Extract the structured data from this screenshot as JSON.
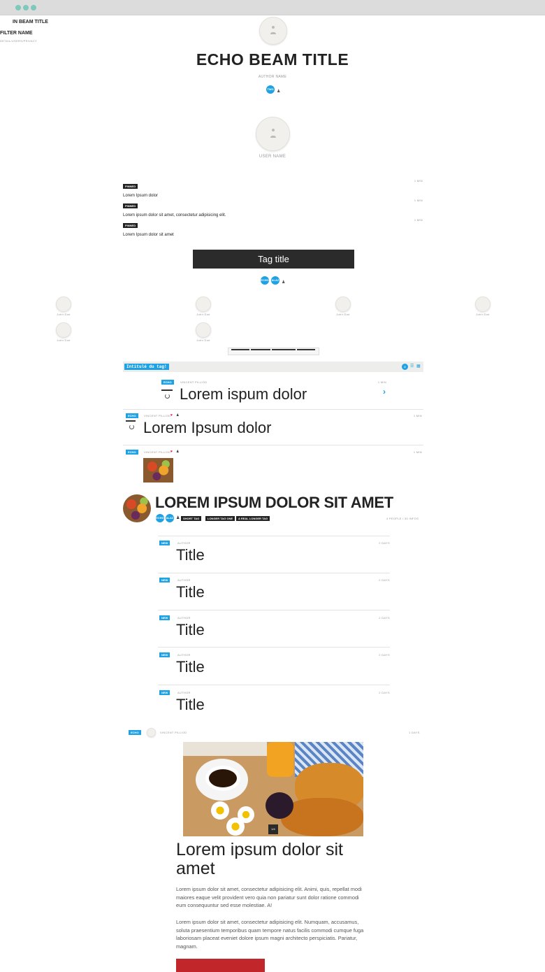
{
  "sidebar": {
    "beam_title": "IN BEAM TITLE",
    "filter_name": "FILTER NAME",
    "filter_sub": "DETAIL/USERS/PRIVACY"
  },
  "header": {
    "title": "ECHO BEAM TITLE",
    "author": "AUTHOR NAME",
    "badge": "TWO",
    "user_name": "USER NAME"
  },
  "pinned": {
    "items": [
      {
        "tag": "PINNED",
        "text": "Lorem Ipsum dolor",
        "meta": "1 MIN"
      },
      {
        "tag": "PINNED",
        "text": "Lorem ipsum dolor sit amet, consectetur adipisicing elit.",
        "meta": "1 MIN"
      },
      {
        "tag": "PINNED",
        "text": "Lorem Ipsum dolor sit amet",
        "meta": "1 MIN"
      }
    ]
  },
  "tag_section": {
    "title": "Tag title",
    "badges": [
      "ECHO",
      "ALAZ"
    ]
  },
  "people": [
    "John Doe",
    "John Doe",
    "John Doe",
    "John Doe",
    "John Doe",
    "John Doe"
  ],
  "beam_bar": {
    "title": "Intitulé du tag!",
    "count": "2"
  },
  "feed": {
    "item1": {
      "badge": "ECHO",
      "author": "VINCENT PILLIOD",
      "title": "Lorem ispum dolor",
      "meta": "1 MIN"
    },
    "item2": {
      "badge": "ECHO",
      "author": "VINCENT PILLIOD",
      "title": "Lorem Ipsum dolor",
      "meta": "1 MIN"
    },
    "item3": {
      "badge": "ECHO",
      "author": "VINCENT PILLIOD",
      "meta": "1 MIN"
    }
  },
  "big_post": {
    "title": "LOREM IPSUM DOLOR SIT AMET",
    "badges": [
      "ECHO",
      "ALAZ"
    ],
    "tags": [
      "SHORT TAG",
      "LONGER TAG ONE",
      "A REAL LONGER TAG"
    ],
    "meta": "4 PEOPLE / 30 INFOS"
  },
  "titles_list": [
    {
      "badge": "NEW",
      "author": "AUTHOR",
      "age": "2 DAYS",
      "title": "Title"
    },
    {
      "badge": "NEW",
      "author": "AUTHOR",
      "age": "2 DAYS",
      "title": "Title"
    },
    {
      "badge": "NEW",
      "author": "AUTHOR",
      "age": "2 DAYS",
      "title": "Title"
    },
    {
      "badge": "NEW",
      "author": "AUTHOR",
      "age": "2 DAYS",
      "title": "Title"
    },
    {
      "badge": "NEW",
      "author": "AUTHOR",
      "age": "2 DAYS",
      "title": "Title"
    }
  ],
  "article": {
    "badge": "ECHO",
    "author": "VINCENT PILLIOD",
    "meta": "1 DAYS",
    "image_badge": "1/4",
    "title": "Lorem ipsum dolor sit amet",
    "para1": "Lorem ipsum dolor sit amet, consectetur adipisicing elit. Animi, quis, repellat modi maiores eaque velit provident vero quia non pariatur sunt dolor ratione commodi eum consequuntur sed esse molestiae. A!",
    "para2": "Lorem ipsum dolor sit amet, consectetur adipisicing elit. Numquam, accusamus, soluta praesentium temporibus quam tempore natus facilis commodi cumque fuga laboriosam placeat eveniet dolore ipsum magni architecto perspiciatis. Pariatur, magnam."
  },
  "colors": {
    "accent": "#1ea2e3",
    "dark": "#222222",
    "window_dots": "#7fc9ba"
  }
}
